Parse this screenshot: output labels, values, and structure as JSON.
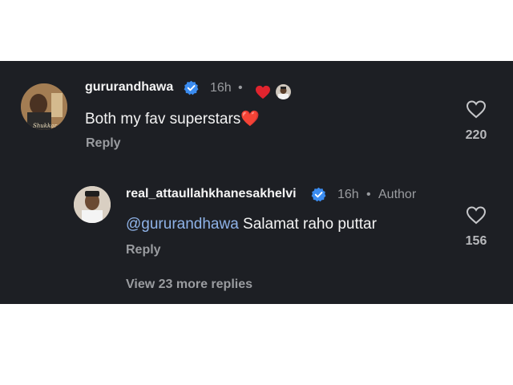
{
  "comment": {
    "username": "gururandhawa",
    "verified_icon": "verified-badge-icon",
    "time": "16h",
    "separator": "•",
    "liked_by_author_icons": [
      "heart-icon",
      "author-avatar-icon"
    ],
    "text": "Both my fav superstars",
    "emoji": "❤️",
    "reply_label": "Reply",
    "likes": "220",
    "avatar_caption": "Shukkar"
  },
  "reply": {
    "username": "real_attaullahkhanesakhelvi",
    "verified_icon": "verified-badge-icon",
    "time": "16h",
    "separator": "•",
    "author_label": "Author",
    "mention": "@gururandhawa",
    "text": " Salamat raho puttar",
    "reply_label": "Reply",
    "likes": "156"
  },
  "view_more_label": "View 23 more replies",
  "colors": {
    "panel_bg": "#1d1f24",
    "verified_blue": "#3b8cf0",
    "heart_red": "#e0242e",
    "mention_blue": "#8fb3e8",
    "muted": "#9a9ca0"
  }
}
